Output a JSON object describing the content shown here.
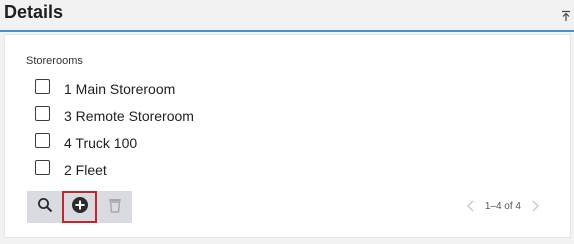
{
  "header": {
    "title": "Details",
    "collapse_icon": "collapse-up-icon"
  },
  "section": {
    "label": "Storerooms"
  },
  "items": [
    {
      "label": "1 Main Storeroom",
      "checked": false
    },
    {
      "label": "3 Remote Storeroom",
      "checked": false
    },
    {
      "label": "4 Truck 100",
      "checked": false
    },
    {
      "label": "2 Fleet",
      "checked": false
    }
  ],
  "toolbar": {
    "search_icon": "search-icon",
    "add_icon": "add-circle-icon",
    "delete_icon": "trash-icon"
  },
  "pager": {
    "text": "1–4 of 4",
    "prev_icon": "chevron-left-icon",
    "next_icon": "chevron-right-icon"
  },
  "colors": {
    "accent": "#4a90c8",
    "highlight": "#c0262d",
    "toolbar_bg": "#d9dbe0"
  }
}
